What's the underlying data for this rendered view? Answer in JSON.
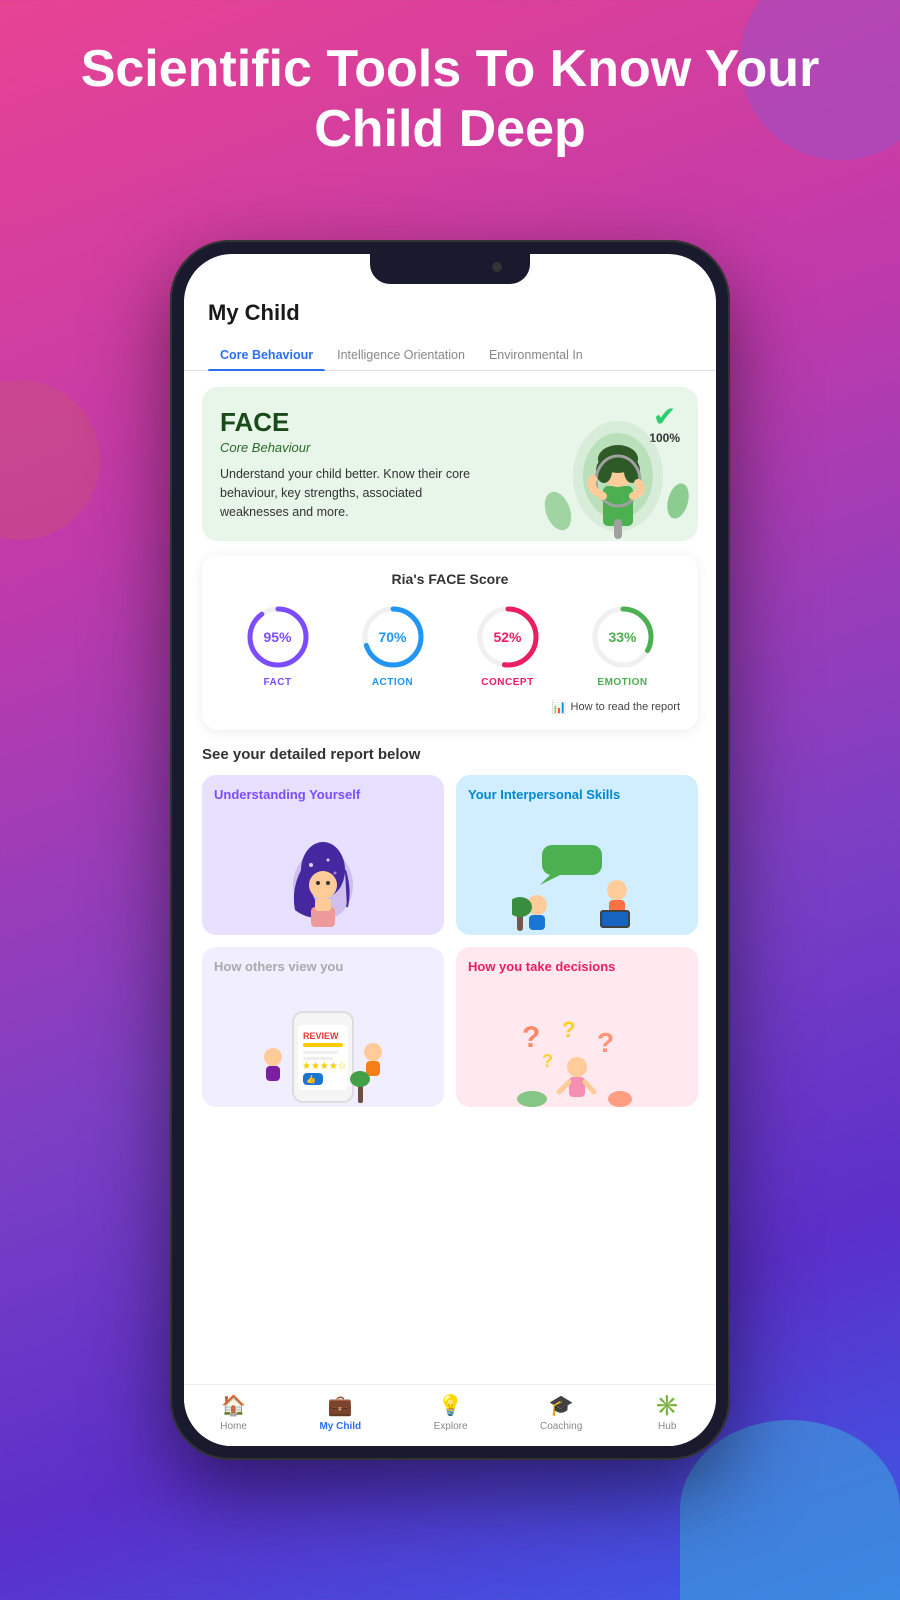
{
  "hero": {
    "title": "Scientific Tools To Know Your Child Deep"
  },
  "app": {
    "header": "My Child",
    "tabs": [
      {
        "id": "core",
        "label": "Core Behaviour",
        "active": true
      },
      {
        "id": "intelligence",
        "label": "Intelligence Orientation",
        "active": false
      },
      {
        "id": "environmental",
        "label": "Environmental In",
        "active": false
      }
    ]
  },
  "face_card": {
    "title": "FACE",
    "subtitle": "Core Behaviour",
    "description": "Understand your child better. Know their core behaviour, key strengths, associated weaknesses and more.",
    "check_percent": "100%"
  },
  "score_card": {
    "title": "Ria's FACE Score",
    "scores": [
      {
        "id": "fact",
        "label": "FACT",
        "value": 95,
        "color": "#7c4dff",
        "display": "95%"
      },
      {
        "id": "action",
        "label": "ACTION",
        "value": 70,
        "color": "#2196f3",
        "display": "70%"
      },
      {
        "id": "concept",
        "label": "CONCEPT",
        "value": 52,
        "color": "#e91e63",
        "display": "52%"
      },
      {
        "id": "emotion",
        "label": "EMOTION",
        "value": 33,
        "color": "#4caf50",
        "display": "33%"
      }
    ],
    "footer": "How to read the report"
  },
  "report_section": {
    "heading": "See your detailed report below",
    "cards": [
      {
        "id": "understanding",
        "title": "Understanding Yourself",
        "title_color": "purple",
        "bg_color": "#e8e0ff",
        "illustration": "girl-space"
      },
      {
        "id": "interpersonal",
        "title": "Your Interpersonal Skills",
        "title_color": "blue",
        "bg_color": "#d0eeff",
        "illustration": "people-chat"
      },
      {
        "id": "others-view",
        "title": "How others view you",
        "title_color": "gray",
        "bg_color": "#f0eeff",
        "illustration": "review-phone"
      },
      {
        "id": "decisions",
        "title": "How you take decisions",
        "title_color": "red",
        "bg_color": "#ffe8ee",
        "illustration": "questions"
      }
    ]
  },
  "bottom_nav": {
    "items": [
      {
        "id": "home",
        "label": "Home",
        "icon": "🏠",
        "active": false
      },
      {
        "id": "my-child",
        "label": "My Child",
        "icon": "💼",
        "active": true
      },
      {
        "id": "explore",
        "label": "Explore",
        "icon": "💡",
        "active": false
      },
      {
        "id": "coaching",
        "label": "Coaching",
        "icon": "🎓",
        "active": false
      },
      {
        "id": "hub",
        "label": "Hub",
        "icon": "✳️",
        "active": false
      }
    ]
  },
  "colors": {
    "fact": "#7c4dff",
    "action": "#2196f3",
    "concept": "#e91e63",
    "emotion": "#4caf50",
    "active_tab": "#2c6fef"
  }
}
